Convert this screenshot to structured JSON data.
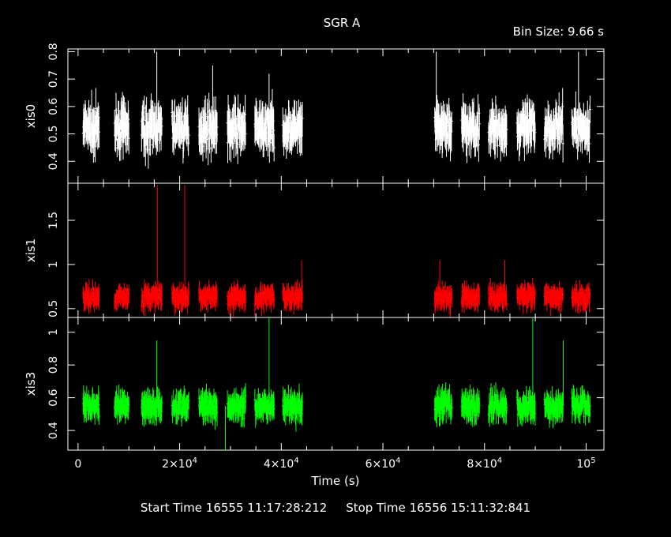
{
  "chart_data": {
    "type": "scatter",
    "title": "SGR A",
    "bin_size_label": "Bin Size: 9.66 s",
    "xlabel": "Time (s)",
    "xlim": [
      -2000,
      103500
    ],
    "x_ticks": [
      {
        "value": 0,
        "label": "0"
      },
      {
        "value": 20000,
        "mant": "2×10",
        "exp": "4"
      },
      {
        "value": 40000,
        "mant": "4×10",
        "exp": "4"
      },
      {
        "value": 60000,
        "mant": "6×10",
        "exp": "4"
      },
      {
        "value": 80000,
        "mant": "8×10",
        "exp": "4"
      },
      {
        "value": 100000,
        "mant": "10",
        "exp": "5"
      }
    ],
    "footer": {
      "start_label": "Start Time",
      "start_value": "16555 11:17:28:212",
      "stop_label": "Stop Time",
      "stop_value": "16556 15:11:32:841"
    },
    "segments": [
      [
        1000,
        4200
      ],
      [
        7200,
        10000
      ],
      [
        12500,
        16500
      ],
      [
        18500,
        21800
      ],
      [
        23800,
        27400
      ],
      [
        29400,
        33000
      ],
      [
        34800,
        38600
      ],
      [
        40300,
        44200
      ],
      [
        70200,
        73600
      ],
      [
        75500,
        79000
      ],
      [
        80800,
        84400
      ],
      [
        86400,
        90000
      ],
      [
        91800,
        95500
      ],
      [
        97200,
        100800
      ]
    ],
    "series": [
      {
        "name": "xis0",
        "color": "#ffffff",
        "ylim": [
          0.32,
          0.81
        ],
        "yticks": [
          {
            "v": 0.4,
            "t": "0.4"
          },
          {
            "v": 0.5,
            "t": "0.5"
          },
          {
            "v": 0.6,
            "t": "0.6"
          },
          {
            "v": 0.7,
            "t": "0.7"
          },
          {
            "v": 0.8,
            "t": "0.8"
          }
        ],
        "mean": 0.52,
        "sd": 0.045,
        "err": 0.055,
        "spikes": [
          [
            15500,
            0.8
          ],
          [
            37600,
            0.72
          ],
          [
            70500,
            0.8
          ],
          [
            98500,
            0.8
          ],
          [
            26500,
            0.75
          ]
        ]
      },
      {
        "name": "xis1",
        "color": "#ff0000",
        "ylim": [
          0.4,
          1.92
        ],
        "yticks": [
          {
            "v": 0.5,
            "t": "0.5"
          },
          {
            "v": 1.0,
            "t": "1"
          },
          {
            "v": 1.5,
            "t": "1.5"
          }
        ],
        "mean": 0.63,
        "sd": 0.07,
        "err": 0.09,
        "spikes": [
          [
            15600,
            1.9
          ],
          [
            21000,
            1.9
          ],
          [
            44000,
            1.05
          ],
          [
            71200,
            1.05
          ],
          [
            84000,
            1.05
          ]
        ]
      },
      {
        "name": "xis3",
        "color": "#00ff00",
        "ylim": [
          0.28,
          1.09
        ],
        "yticks": [
          {
            "v": 0.4,
            "t": "0.4"
          },
          {
            "v": 0.6,
            "t": "0.6"
          },
          {
            "v": 0.8,
            "t": "0.8"
          },
          {
            "v": 1.0,
            "t": "1"
          }
        ],
        "mean": 0.55,
        "sd": 0.05,
        "err": 0.06,
        "spikes": [
          [
            15500,
            0.95
          ],
          [
            37600,
            1.09
          ],
          [
            89500,
            1.09
          ],
          [
            95500,
            0.95
          ],
          [
            29000,
            0.28
          ]
        ]
      }
    ]
  }
}
